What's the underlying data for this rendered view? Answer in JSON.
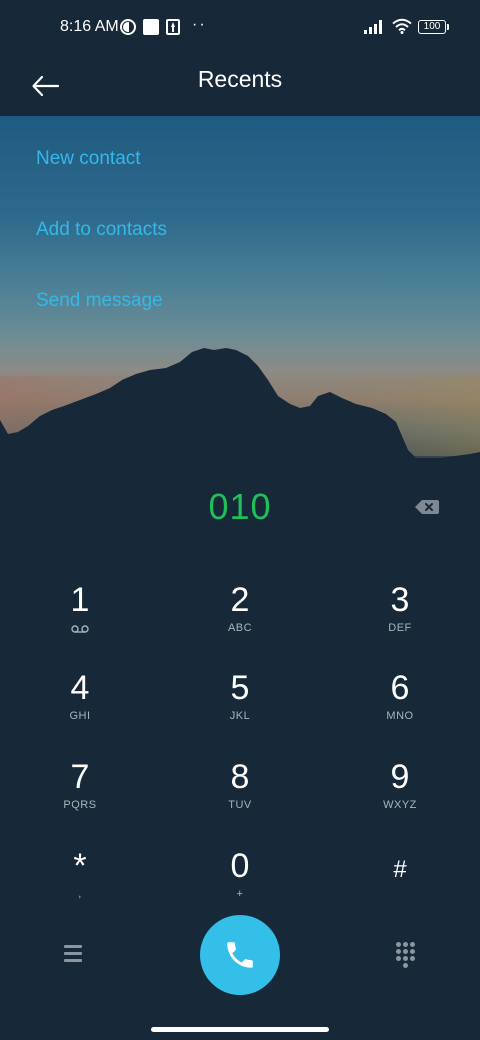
{
  "status_bar": {
    "time": "8:16 AM",
    "dots": "··",
    "battery": "100",
    "icons": [
      "notification-icon",
      "square-notification-icon",
      "upload-icon",
      "signal-icon",
      "wifi-icon",
      "battery-icon"
    ]
  },
  "header": {
    "title": "Recents",
    "back_icon": "back-arrow-icon"
  },
  "actions": {
    "new_contact": "New contact",
    "add_to_contacts": "Add to contacts",
    "send_message": "Send message"
  },
  "dialer": {
    "number": "010",
    "backspace_icon": "backspace-icon"
  },
  "keypad": {
    "keys": [
      {
        "digit": "1",
        "letters": ""
      },
      {
        "digit": "2",
        "letters": "ABC"
      },
      {
        "digit": "3",
        "letters": "DEF"
      },
      {
        "digit": "4",
        "letters": "GHI"
      },
      {
        "digit": "5",
        "letters": "JKL"
      },
      {
        "digit": "6",
        "letters": "MNO"
      },
      {
        "digit": "7",
        "letters": "PQRS"
      },
      {
        "digit": "8",
        "letters": "TUV"
      },
      {
        "digit": "9",
        "letters": "WXYZ"
      },
      {
        "digit": "*",
        "letters": ","
      },
      {
        "digit": "0",
        "letters": "+"
      },
      {
        "digit": "#",
        "letters": ""
      }
    ]
  },
  "bottom_bar": {
    "menu_icon": "menu-icon",
    "call_icon": "phone-icon",
    "dialpad_icon": "dialpad-icon"
  },
  "colors": {
    "background": "#172938",
    "accent": "#33bfe8",
    "link": "#33b8e8",
    "number": "#1fc05a"
  }
}
